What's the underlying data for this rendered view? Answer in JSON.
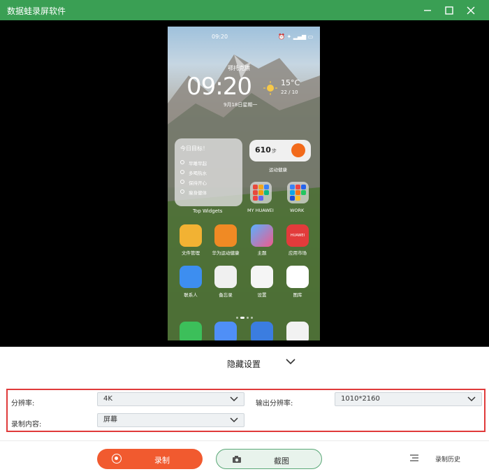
{
  "window": {
    "title": "数据蛙录屏软件",
    "controls": [
      "minimize-icon",
      "maximize-icon",
      "close-icon"
    ],
    "accent_color": "#3a9f54"
  },
  "phone": {
    "status_time": "09:20",
    "location": "鄂托克旗",
    "clock": "09:20",
    "date": "9月18日星期一",
    "temperature": "15°C",
    "temp_range": "22 / 10",
    "widget": {
      "title": "今日目标！",
      "items": [
        "早睡早起",
        "多喝热水",
        "保持开心",
        "瘦身健体"
      ],
      "label": "Top Widgets"
    },
    "steps": {
      "value": "610",
      "unit": "步",
      "label": "运动健康"
    },
    "folders": [
      {
        "label": "MY HUAWEI"
      },
      {
        "label": "WORK"
      }
    ],
    "apps_row1": [
      {
        "label": "文件管理"
      },
      {
        "label": "华为运动健康"
      },
      {
        "label": "主题"
      },
      {
        "label": "应用市场",
        "badge": "HUAWEI"
      }
    ],
    "apps_row2": [
      {
        "label": "联系人"
      },
      {
        "label": "备忘录"
      },
      {
        "label": "设置"
      },
      {
        "label": "图库"
      }
    ],
    "dock": [
      "phone-icon",
      "messages-icon",
      "browser-icon",
      "camera-icon"
    ]
  },
  "hide_settings": {
    "label": "隐藏设置"
  },
  "settings": {
    "resolution_label": "分辨率:",
    "resolution_value": "4K",
    "output_label": "输出分辨率:",
    "output_value": "1010*2160",
    "content_label": "录制内容:",
    "content_value": "屏幕",
    "highlight_color": "#e03a3a"
  },
  "actions": {
    "record_label": "录制",
    "record_color": "#f15a2f",
    "screenshot_label": "截图",
    "history_label": "录制历史"
  }
}
